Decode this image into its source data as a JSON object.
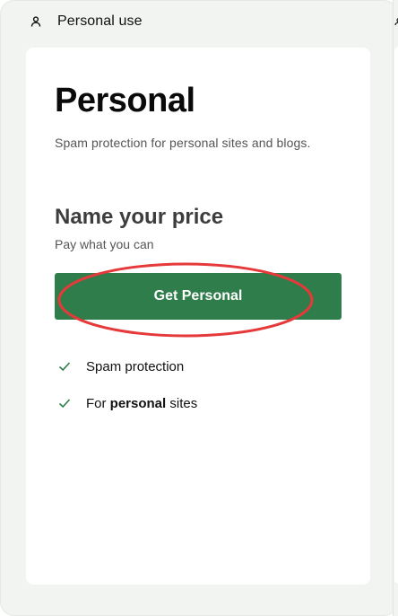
{
  "header": {
    "title": "Personal use",
    "icon": "user-icon"
  },
  "plan": {
    "name": "Personal",
    "description": "Spam protection for personal sites and blogs."
  },
  "pricing": {
    "title": "Name your price",
    "subtitle": "Pay what you can"
  },
  "cta": {
    "label": "Get Personal"
  },
  "features": [
    {
      "icon": "check-icon",
      "text": "Spam protection"
    },
    {
      "icon": "check-icon",
      "prefix": "For ",
      "bold": "personal",
      "suffix": " sites"
    }
  ],
  "colors": {
    "accent": "#2f7d4a",
    "annotation": "#e5393a",
    "panel_bg": "#f2f4f2",
    "card_bg": "#ffffff"
  }
}
